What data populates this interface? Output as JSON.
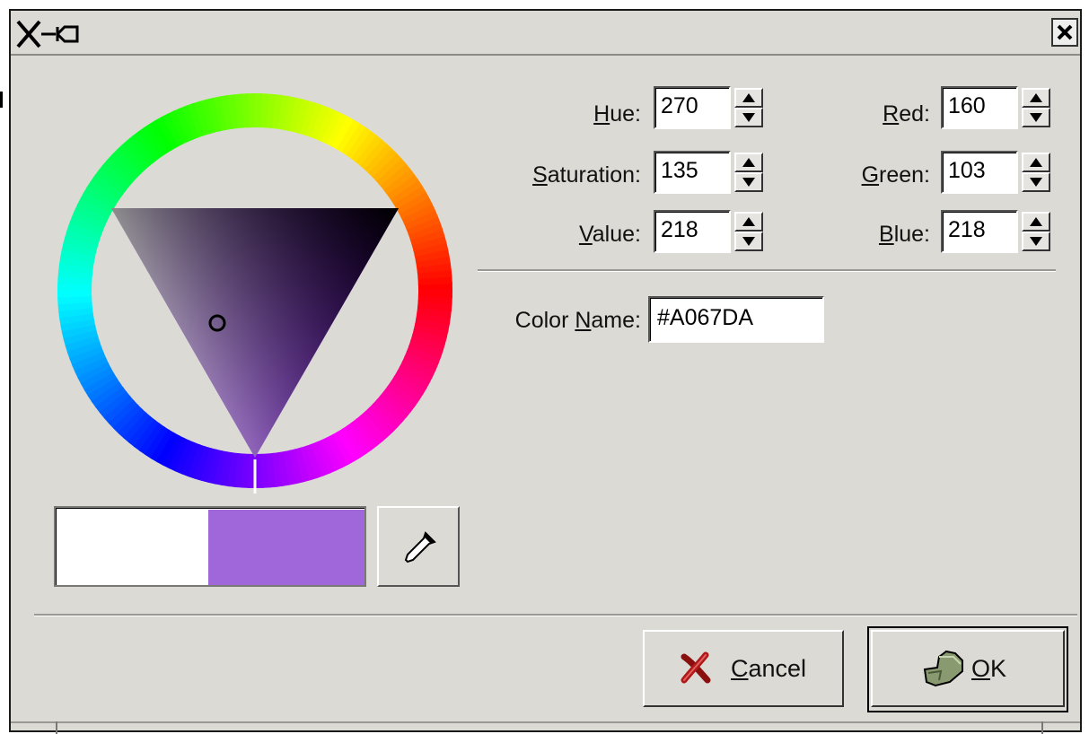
{
  "window": {
    "close_icon": "close-icon",
    "titlebar_icon": "x-pin-icon"
  },
  "hsv": {
    "hue_label_pre": "",
    "hue_label_key": "H",
    "hue_label_post": "ue:",
    "hue_value": "270",
    "saturation_label_key": "S",
    "saturation_label_post": "aturation:",
    "saturation_value": "135",
    "value_label_key": "V",
    "value_label_post": "alue:",
    "value_value": "218"
  },
  "rgb": {
    "red_label_key": "R",
    "red_label_post": "ed:",
    "red_value": "160",
    "green_label_key": "G",
    "green_label_post": "reen:",
    "green_value": "103",
    "blue_label_key": "B",
    "blue_label_post": "lue:",
    "blue_value": "218"
  },
  "color_name": {
    "label_pre": "Color ",
    "label_key": "N",
    "label_post": "ame:",
    "value": "#A067DA"
  },
  "swatches": {
    "previous_color": "#ffffff",
    "current_color": "#a067da"
  },
  "wheel": {
    "selected_hue_deg": 270,
    "triangle_hue_color": "#7000e0"
  },
  "buttons": {
    "cancel_key": "C",
    "cancel_rest": "ancel",
    "ok_key": "O",
    "ok_rest": "K",
    "cancel_icon": "cancel-x-icon",
    "ok_icon": "ok-hand-icon",
    "picker_icon": "eyedropper-icon"
  }
}
